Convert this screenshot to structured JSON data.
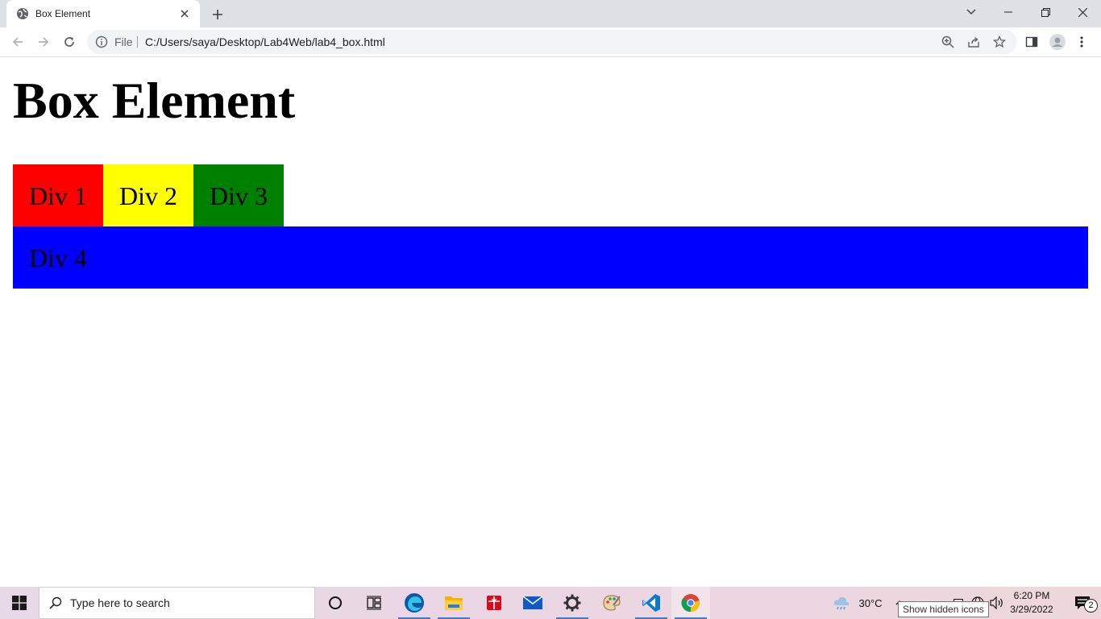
{
  "browser": {
    "tab_title": "Box Element",
    "address_scheme_chip": "File",
    "url": "C:/Users/saya/Desktop/Lab4Web/lab4_box.html"
  },
  "page": {
    "heading": "Box Element",
    "boxes": [
      {
        "label": "Div 1",
        "color": "#ff0000"
      },
      {
        "label": "Div 2",
        "color": "#ffff00"
      },
      {
        "label": "Div 3",
        "color": "#008000"
      },
      {
        "label": "Div 4",
        "color": "#0000ff"
      }
    ]
  },
  "taskbar": {
    "search_placeholder": "Type here to search",
    "weather_temp": "30°C",
    "time": "6:20 PM",
    "date": "3/29/2022",
    "notification_count": "2",
    "tooltip": "Show hidden icons"
  }
}
